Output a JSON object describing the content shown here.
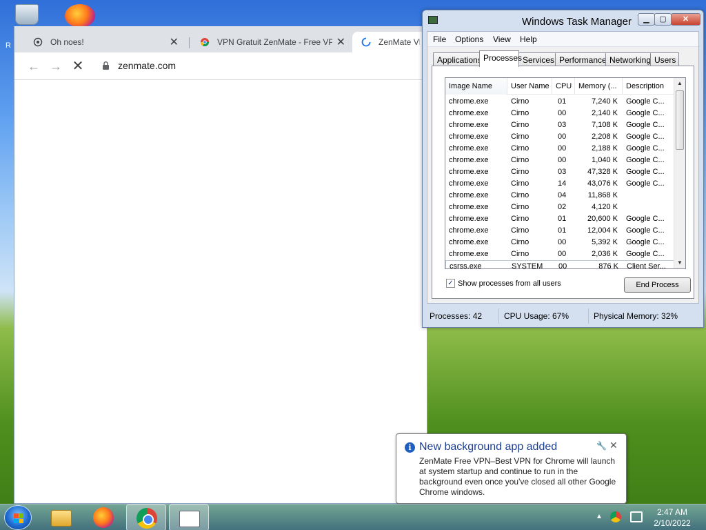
{
  "desktop": {
    "icon_letter": "R"
  },
  "browser": {
    "tabs": [
      {
        "title": "Oh noes!",
        "icon": "snapshot-icon"
      },
      {
        "title": "VPN Gratuit ZenMate - Free VPN",
        "icon": "chrome-webstore-icon"
      },
      {
        "title": "ZenMate VPN",
        "icon": "loading-spinner-icon"
      }
    ],
    "url": "zenmate.com"
  },
  "task_manager": {
    "title": "Windows Task Manager",
    "menu": [
      "File",
      "Options",
      "View",
      "Help"
    ],
    "tabs": [
      "Applications",
      "Processes",
      "Services",
      "Performance",
      "Networking",
      "Users"
    ],
    "active_tab": "Processes",
    "columns": [
      "Image Name",
      "User Name",
      "CPU",
      "Memory (...",
      "Description"
    ],
    "rows": [
      [
        "chrome.exe",
        "Cirno",
        "01",
        "7,240 K",
        "Google C..."
      ],
      [
        "chrome.exe",
        "Cirno",
        "00",
        "2,140 K",
        "Google C..."
      ],
      [
        "chrome.exe",
        "Cirno",
        "03",
        "7,108 K",
        "Google C..."
      ],
      [
        "chrome.exe",
        "Cirno",
        "00",
        "2,208 K",
        "Google C..."
      ],
      [
        "chrome.exe",
        "Cirno",
        "00",
        "2,188 K",
        "Google C..."
      ],
      [
        "chrome.exe",
        "Cirno",
        "00",
        "1,040 K",
        "Google C..."
      ],
      [
        "chrome.exe",
        "Cirno",
        "03",
        "47,328 K",
        "Google C..."
      ],
      [
        "chrome.exe",
        "Cirno",
        "14",
        "43,076 K",
        "Google C..."
      ],
      [
        "chrome.exe",
        "Cirno",
        "04",
        "11,868 K",
        ""
      ],
      [
        "chrome.exe",
        "Cirno",
        "02",
        "4,120 K",
        ""
      ],
      [
        "chrome.exe",
        "Cirno",
        "01",
        "20,600 K",
        "Google C..."
      ],
      [
        "chrome.exe",
        "Cirno",
        "01",
        "12,004 K",
        "Google C..."
      ],
      [
        "chrome.exe",
        "Cirno",
        "00",
        "5,392 K",
        "Google C..."
      ],
      [
        "chrome.exe",
        "Cirno",
        "00",
        "2,036 K",
        "Google C..."
      ],
      [
        "csrss.exe",
        "SYSTEM",
        "00",
        "876 K",
        "Client Ser..."
      ]
    ],
    "show_all_users_label": "Show processes from all users",
    "show_all_users_checked": true,
    "end_process_label": "End Process",
    "status": {
      "processes": "Processes: 42",
      "cpu": "CPU Usage: 67%",
      "memory": "Physical Memory: 32%"
    }
  },
  "notification": {
    "title": "New background app added",
    "body": "ZenMate Free VPN–Best VPN for Chrome will launch at system startup and continue to run in the background even once you've closed all other Google Chrome windows."
  },
  "taskbar": {
    "pinned": [
      "windows-explorer-icon",
      "firefox-icon",
      "chrome-icon",
      "task-manager-icon"
    ],
    "time": "2:47 AM",
    "date": "2/10/2022"
  }
}
